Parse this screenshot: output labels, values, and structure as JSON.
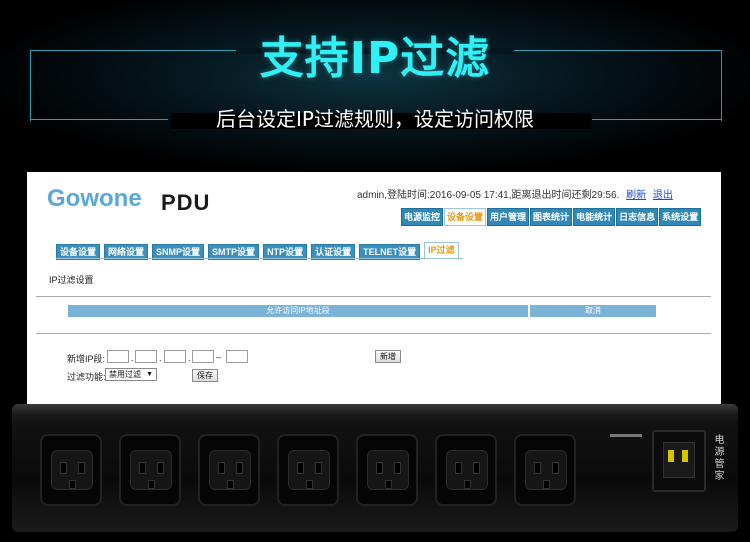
{
  "banner": {
    "title": "支持IP过滤",
    "subtitle": "后台设定IP过滤规则，设定访问权限"
  },
  "colors": {
    "title_cyan": "#2ff0f5",
    "frame_line": "#2a9fb0",
    "nav_blue": "#2f88b6",
    "active_orange": "#e39c1d",
    "logo_blue": "#5aa8d8",
    "table_header": "#7ab3d6",
    "power_plug_yellow": "#d8c200"
  },
  "app": {
    "logo": "Gowone",
    "product": "PDU",
    "user_info": "admin,登陆时间:2016-09-05 17:41,距离退出时间还剩29:56.",
    "refresh_link": "刷新",
    "logout_link": "退出"
  },
  "top_nav": [
    {
      "label": "电源监控",
      "active": false
    },
    {
      "label": "设备设置",
      "active": true
    },
    {
      "label": "用户管理",
      "active": false
    },
    {
      "label": "图表统计",
      "active": false
    },
    {
      "label": "电能统计",
      "active": false
    },
    {
      "label": "日志信息",
      "active": false
    },
    {
      "label": "系统设置",
      "active": false
    }
  ],
  "sub_tabs": [
    {
      "label": "设备设置",
      "active": false
    },
    {
      "label": "网络设置",
      "active": false
    },
    {
      "label": "SNMP设置",
      "active": false
    },
    {
      "label": "SMTP设置",
      "active": false
    },
    {
      "label": "NTP设置",
      "active": false
    },
    {
      "label": "认证设置",
      "active": false
    },
    {
      "label": "TELNET设置",
      "active": false
    },
    {
      "label": "IP过滤",
      "active": true
    }
  ],
  "ip_filter": {
    "section_title": "IP过滤设置",
    "table_headers": [
      "允许访问IP地址段",
      "取消"
    ],
    "new_ip_label": "新增IP段:",
    "ip_separator": ".",
    "range_separator": "–",
    "add_button": "新增",
    "filter_label": "过滤功能:",
    "filter_select_value": "禁用过滤",
    "select_arrow": "▼",
    "save_button": "保存"
  },
  "pdu_device": {
    "outlet_count": 7,
    "side_label": "电源管家"
  }
}
